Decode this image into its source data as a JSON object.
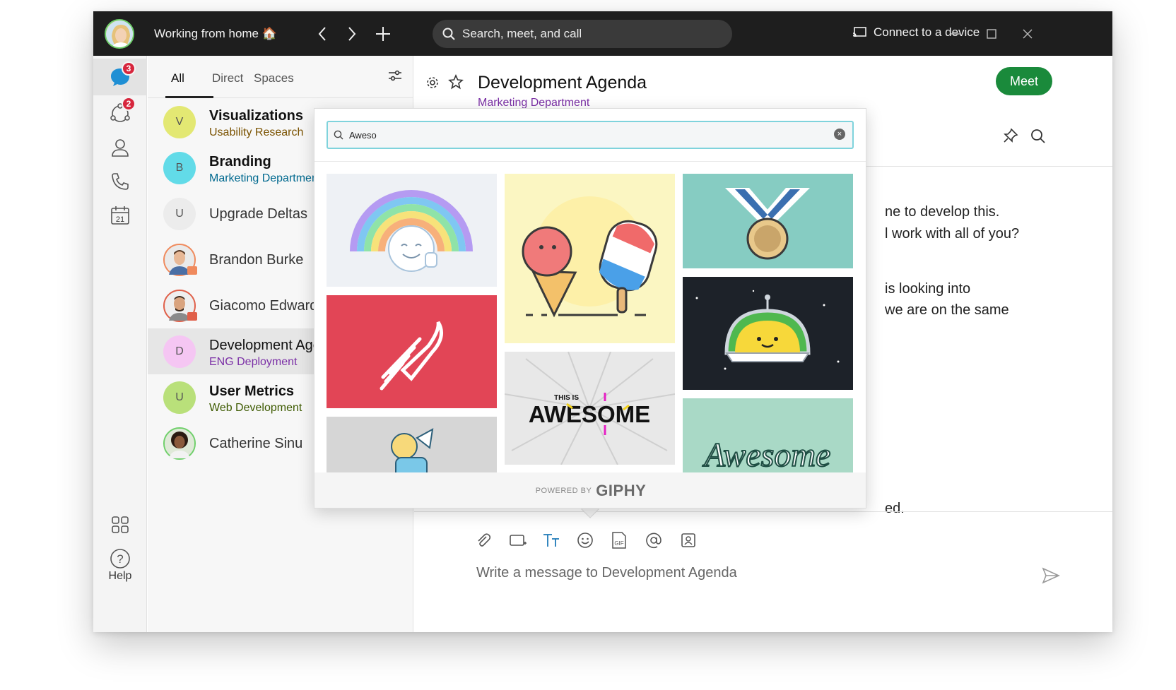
{
  "titlebar": {
    "status": "Working from home 🏠",
    "search_placeholder": "Search, meet, and call",
    "connect_label": "Connect to a device"
  },
  "rail": {
    "messaging_badge": "3",
    "teams_badge": "2",
    "calendar_day": "21",
    "help_label": "Help"
  },
  "list": {
    "tabs": [
      "All",
      "Direct",
      "Spaces"
    ],
    "conversations": [
      {
        "initial": "V",
        "title": "Visualizations",
        "subtitle": "Usability Research"
      },
      {
        "initial": "B",
        "title": "Branding",
        "subtitle": "Marketing Department"
      },
      {
        "initial": "U",
        "title": "Upgrade Deltas",
        "subtitle": ""
      },
      {
        "initial": "",
        "title": "Brandon Burke",
        "subtitle": ""
      },
      {
        "initial": "",
        "title": "Giacomo Edwards",
        "subtitle": ""
      },
      {
        "initial": "D",
        "title": "Development Agenda",
        "subtitle": "ENG Deployment"
      },
      {
        "initial": "U",
        "title": "User Metrics",
        "subtitle": "Web Development"
      },
      {
        "initial": "",
        "title": "Catherine Sinu",
        "subtitle": ""
      }
    ]
  },
  "main": {
    "title": "Development Agenda",
    "subtitle": "Marketing Department",
    "meet_label": "Meet",
    "messages": [
      "ne to develop this.",
      "l work with all of you?",
      "is looking into",
      "we are on the same",
      "ed."
    ],
    "compose_placeholder": "Write a message to Development Agenda"
  },
  "gif_picker": {
    "query": "Aweso",
    "clear_symbol": "×",
    "powered_by": "POWERED BY",
    "brand": "GIPHY",
    "awesome_small": "THIS IS",
    "awesome_big": "AWESOME",
    "awesome_script": "Awesome"
  },
  "colors": {
    "titlebar": "#1e1e1e",
    "meet_button": "#1a8a3b",
    "subtitle_purple": "#7b2fa6",
    "badge_red": "#d7263d",
    "search_focus": "#7fd3dc"
  }
}
